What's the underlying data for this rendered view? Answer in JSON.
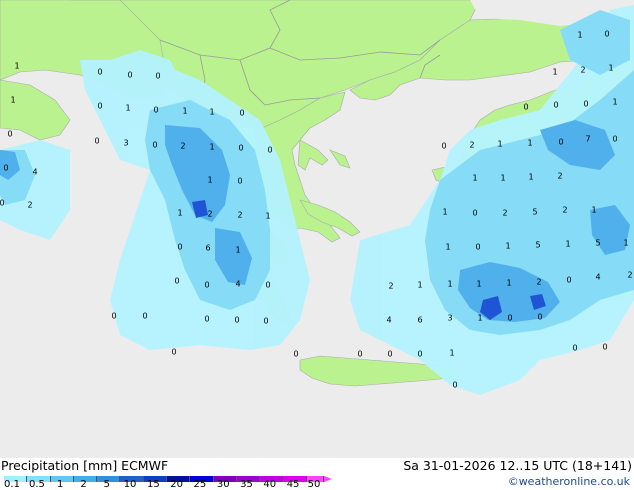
{
  "header": {
    "title": "Precipitation [mm]  ECMWF",
    "datetime": "Sa 31-01-2026 12..15 UTC (18+141)",
    "credit": "©weatheronline.co.uk"
  },
  "legend": {
    "ticks": [
      "0.1",
      "0.5",
      "1",
      "2",
      "5",
      "10",
      "15",
      "20",
      "25",
      "30",
      "35",
      "40",
      "45",
      "50"
    ],
    "colors": [
      "#a0f0ff",
      "#80e0ff",
      "#60c8f0",
      "#40b0e8",
      "#3090e0",
      "#2060d0",
      "#1040c0",
      "#0010a0",
      "#0000e0",
      "#8000c0",
      "#a000d0",
      "#c000e0",
      "#e000f0",
      "#ff40ff"
    ]
  },
  "colors": {
    "sea": "#ececec",
    "land": "#b9f28f",
    "border": "#9a9a9a",
    "precip_light": "#b4f3ff",
    "precip_medium": "#86dcf6",
    "precip_heavy": "#4fb0ec",
    "precip_max": "#1f55d4"
  },
  "map_values": {
    "labels": [
      "1",
      "0",
      "0",
      "0",
      "1",
      "0",
      "1",
      "0",
      "1",
      "1",
      "0",
      "0",
      "0",
      "3",
      "0",
      "2",
      "1",
      "0",
      "0",
      "0",
      "4",
      "1",
      "0",
      "0",
      "2",
      "1",
      "2",
      "2",
      "1",
      "0",
      "6",
      "1",
      "0",
      "4",
      "0",
      "0",
      "0",
      "0",
      "0",
      "0",
      "0",
      "0",
      "0",
      "0",
      "0",
      "0",
      "1",
      "1",
      "0",
      "1",
      "2",
      "1",
      "0",
      "0",
      "0",
      "1",
      "0",
      "2",
      "1",
      "1",
      "0",
      "7",
      "0",
      "1",
      "1",
      "1",
      "2",
      "1",
      "0",
      "2",
      "5",
      "2",
      "1",
      "1",
      "0",
      "1",
      "5",
      "1",
      "5",
      "1",
      "2",
      "1",
      "1",
      "1",
      "1",
      "2",
      "0",
      "4",
      "2",
      "4",
      "6",
      "3",
      "1",
      "0",
      "0",
      "0",
      "0",
      "0",
      "0"
    ]
  }
}
